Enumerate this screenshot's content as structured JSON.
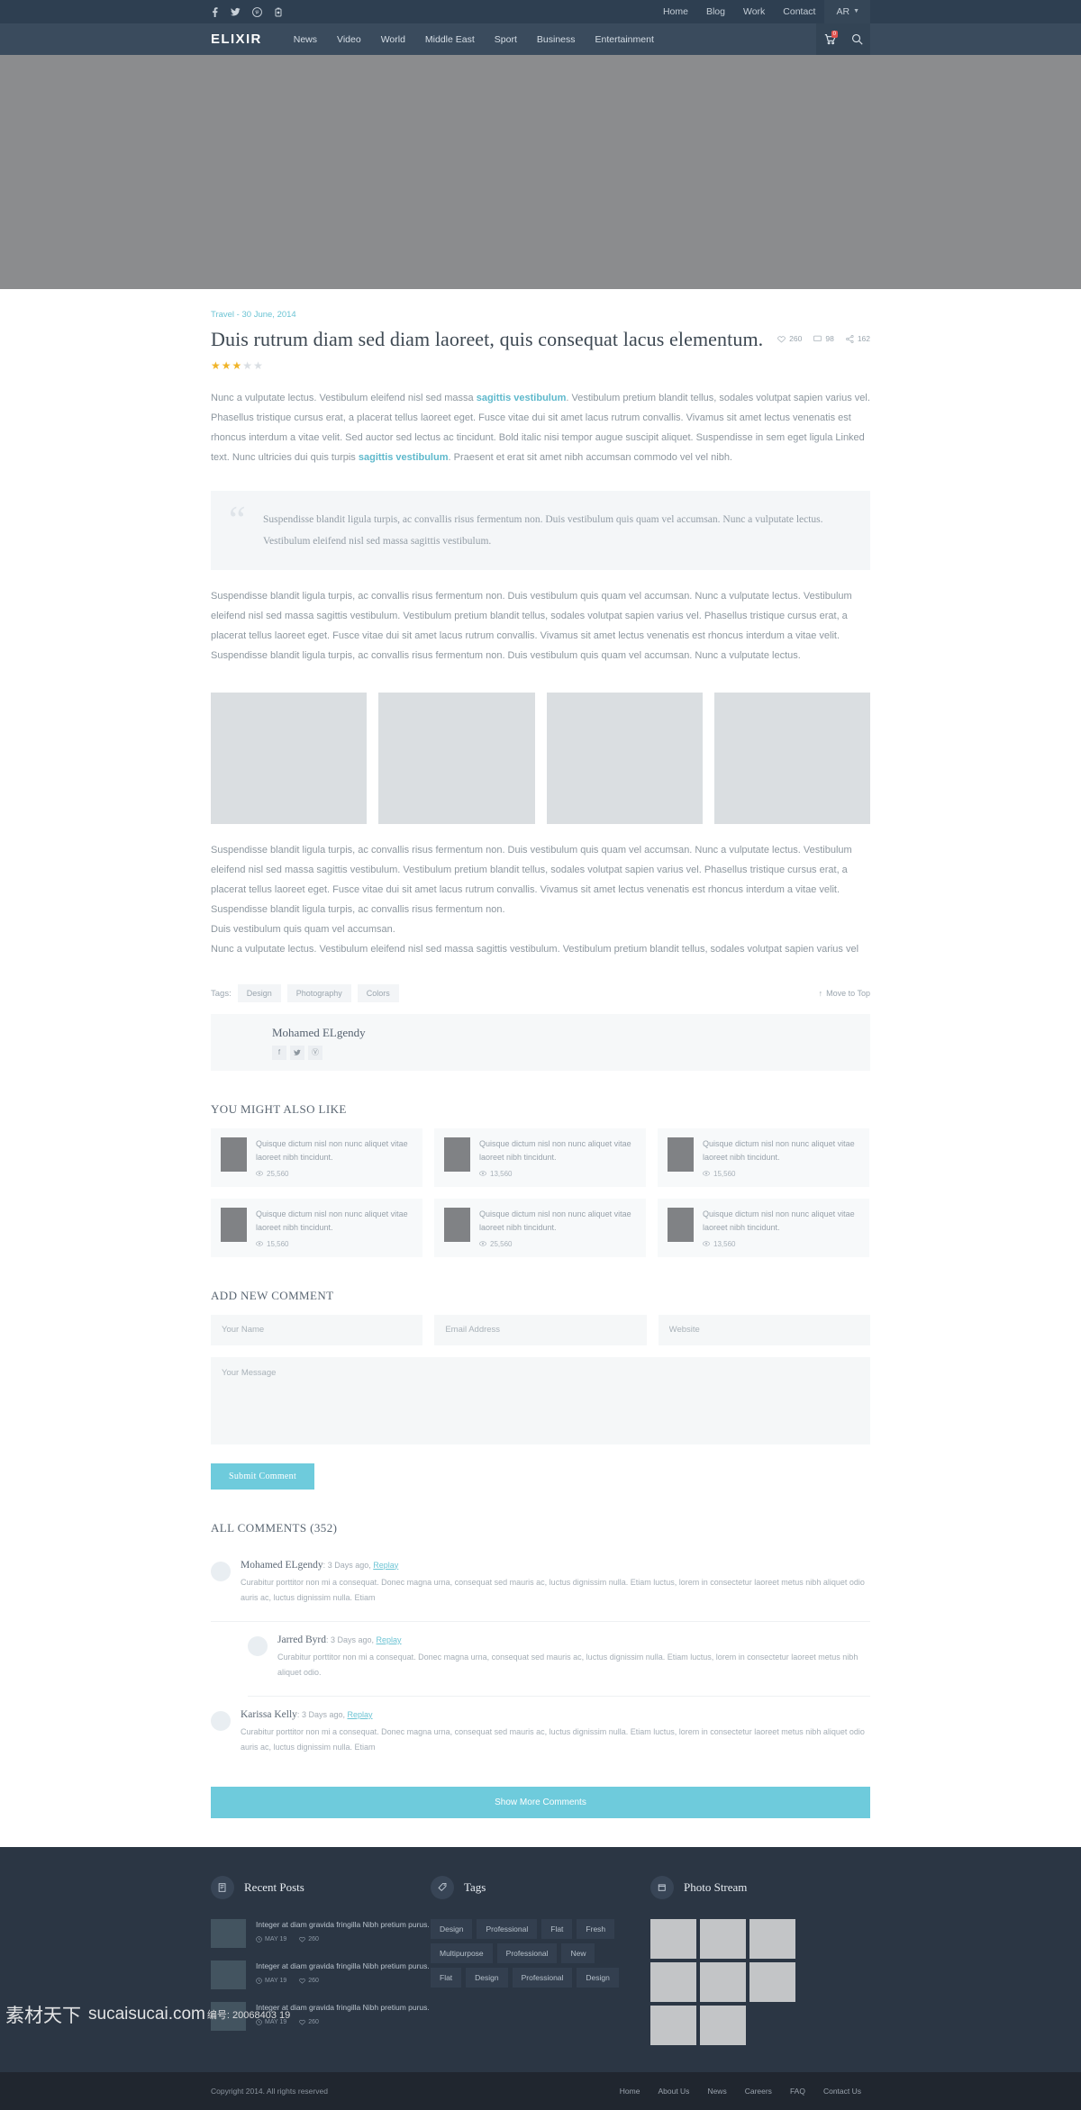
{
  "topbar": {
    "social": [
      {
        "name": "facebook-icon",
        "glyph": "f"
      },
      {
        "name": "twitter-icon",
        "glyph": "ᵗ"
      },
      {
        "name": "pinterest-icon",
        "glyph": "Ⓟ"
      },
      {
        "name": "youtube-icon",
        "glyph": "▶"
      }
    ],
    "links": [
      "Home",
      "Blog",
      "Work",
      "Contact"
    ],
    "language": "AR"
  },
  "mainnav": {
    "brand": "ELIXIR",
    "links": [
      "News",
      "Video",
      "World",
      "Middle East",
      "Sport",
      "Business",
      "Entertainment"
    ],
    "cart_badge": "0"
  },
  "article": {
    "category": "Travel",
    "date": "30 June, 2014",
    "meta": "Travel - 30 June, 2014",
    "title": "Duis rutrum diam sed diam laoreet, quis consequat lacus elementum.",
    "likes": "260",
    "comments": "98",
    "shares": "162",
    "rating": 3,
    "rating_max": 5,
    "paragraph1_a": "Nunc a vulputate lectus. Vestibulum eleifend nisl sed massa ",
    "paragraph1_link1": "sagittis vestibulum",
    "paragraph1_b": ". Vestibulum pretium blandit tellus, sodales volutpat sapien varius vel. Phasellus tristique cursus erat, a placerat tellus laoreet eget. Fusce vitae dui sit amet lacus rutrum convallis. Vivamus sit amet lectus venenatis est rhoncus interdum a vitae velit. Sed auctor sed lectus ac tincidunt. Bold italic nisi tempor augue suscipit aliquet. Suspendisse in sem eget ligula Linked text. Nunc ultricies dui quis turpis ",
    "paragraph1_link2": "sagittis vestibulum",
    "paragraph1_c": ". Praesent et erat sit amet nibh accumsan commodo vel vel nibh.",
    "quote": "Suspendisse blandit ligula turpis, ac convallis risus fermentum non. Duis vestibulum quis quam vel accumsan. Nunc a vulputate lectus. Vestibulum eleifend nisl sed massa sagittis vestibulum.",
    "paragraph2": "Suspendisse blandit ligula turpis, ac convallis risus fermentum non. Duis vestibulum quis quam vel accumsan. Nunc a vulputate lectus. Vestibulum eleifend nisl sed massa sagittis vestibulum. Vestibulum pretium blandit tellus, sodales volutpat sapien varius vel. Phasellus tristique cursus erat, a placerat tellus laoreet eget. Fusce vitae dui sit amet lacus rutrum convallis. Vivamus sit amet lectus venenatis est rhoncus interdum a vitae velit. Suspendisse blandit ligula turpis, ac convallis risus fermentum non. Duis vestibulum quis quam vel accumsan. Nunc a vulputate lectus.",
    "paragraph3_line1": "Suspendisse blandit ligula turpis, ac convallis risus fermentum non. Duis vestibulum quis quam vel accumsan. Nunc a vulputate lectus. Vestibulum eleifend nisl sed massa sagittis vestibulum. Vestibulum pretium blandit tellus, sodales volutpat sapien varius vel. Phasellus tristique cursus erat, a placerat tellus laoreet eget. Fusce vitae dui sit amet lacus rutrum convallis. Vivamus sit amet lectus venenatis est rhoncus interdum a vitae velit.",
    "paragraph3_line2": "Suspendisse blandit ligula turpis, ac convallis risus fermentum non.",
    "paragraph3_line3": "Duis vestibulum quis quam vel accumsan.",
    "paragraph3_line4": "Nunc a vulputate lectus. Vestibulum eleifend nisl sed massa sagittis vestibulum. Vestibulum pretium blandit tellus, sodales volutpat sapien varius vel"
  },
  "tags_section": {
    "label": "Tags:",
    "items": [
      "Design",
      "Photography",
      "Colors"
    ],
    "move_to_top": "Move to Top"
  },
  "author": {
    "name": "Mohamed ELgendy",
    "social": [
      {
        "name": "facebook-icon",
        "glyph": "f"
      },
      {
        "name": "twitter-icon",
        "glyph": "ᵗ"
      },
      {
        "name": "pinterest-icon",
        "glyph": "Ⓟ"
      }
    ]
  },
  "related": {
    "heading": "YOU MIGHT ALSO LIKE",
    "items": [
      {
        "title": "Quisque dictum nisl non nunc aliquet vitae laoreet nibh tincidunt.",
        "views": "25,560"
      },
      {
        "title": "Quisque dictum nisl non nunc aliquet vitae laoreet nibh tincidunt.",
        "views": "13,560"
      },
      {
        "title": "Quisque dictum nisl non nunc aliquet vitae laoreet nibh tincidunt.",
        "views": "15,560"
      },
      {
        "title": "Quisque dictum nisl non nunc aliquet vitae laoreet nibh tincidunt.",
        "views": "15,560"
      },
      {
        "title": "Quisque dictum nisl non nunc aliquet vitae laoreet nibh tincidunt.",
        "views": "25,560"
      },
      {
        "title": "Quisque dictum nisl non nunc aliquet vitae laoreet nibh tincidunt.",
        "views": "13,560"
      }
    ]
  },
  "comment_form": {
    "heading": "ADD NEW COMMENT",
    "name_placeholder": "Your Name",
    "email_placeholder": "Email Address",
    "website_placeholder": "Website",
    "message_placeholder": "Your Message",
    "submit_label": "Submit Comment"
  },
  "comments": {
    "heading": "ALL COMMENTS (352)",
    "count": "352",
    "items": [
      {
        "name": "Mohamed ELgendy",
        "time": "3 Days ago,",
        "reply": "Replay",
        "body": "Curabitur porttitor non mi a consequat. Donec magna urna, consequat sed mauris ac, luctus dignissim nulla. Etiam luctus, lorem in consectetur laoreet metus nibh aliquet odio auris ac, luctus dignissim nulla. Etiam",
        "nested": false
      },
      {
        "name": "Jarred Byrd",
        "time": "3 Days ago,",
        "reply": "Replay",
        "body": "Curabitur porttitor non mi a consequat. Donec magna urna, consequat sed mauris ac, luctus dignissim nulla. Etiam luctus, lorem in consectetur laoreet metus nibh aliquet odio.",
        "nested": true
      },
      {
        "name": "Karissa Kelly",
        "time": "3 Days ago,",
        "reply": "Replay",
        "body": "Curabitur porttitor non mi a consequat. Donec magna urna, consequat sed mauris ac, luctus dignissim nulla. Etiam luctus, lorem in consectetur laoreet metus nibh aliquet odio auris ac, luctus dignissim nulla. Etiam",
        "nested": false
      }
    ],
    "show_more_label": "Show More Comments"
  },
  "footer": {
    "recent_posts": {
      "heading": "Recent Posts",
      "items": [
        {
          "title": "Integer at diam gravida fringilla Nibh pretium purus.",
          "date": "MAY 19",
          "likes": "260"
        },
        {
          "title": "Integer at diam gravida fringilla Nibh pretium purus.",
          "date": "MAY 19",
          "likes": "260"
        },
        {
          "title": "Integer at diam gravida fringilla Nibh pretium purus.",
          "date": "MAY 19",
          "likes": "260"
        }
      ]
    },
    "tags": {
      "heading": "Tags",
      "items": [
        "Design",
        "Professional",
        "Flat",
        "Fresh",
        "Multipurpose",
        "Professional",
        "New",
        "Flat",
        "Design",
        "Professional",
        "Design"
      ]
    },
    "photo_stream": {
      "heading": "Photo Stream",
      "count": 8
    },
    "bottom": {
      "copyright": "Copyright 2014. All rights reserved",
      "links": [
        "Home",
        "About Us",
        "News",
        "Careers",
        "FAQ",
        "Contact Us"
      ]
    }
  },
  "watermark": {
    "cn": "素材天下",
    "site": "sucaisucai.com",
    "code": "编号: 20068403 19"
  },
  "colors": {
    "topbar_bg": "#2e3f51",
    "nav_bg": "#3a4b5d",
    "accent": "#6ecbdc",
    "link": "#5fb9cc",
    "footer_bg": "#2b3644",
    "bottom_bg": "#20262f",
    "star": "#f0b429"
  }
}
